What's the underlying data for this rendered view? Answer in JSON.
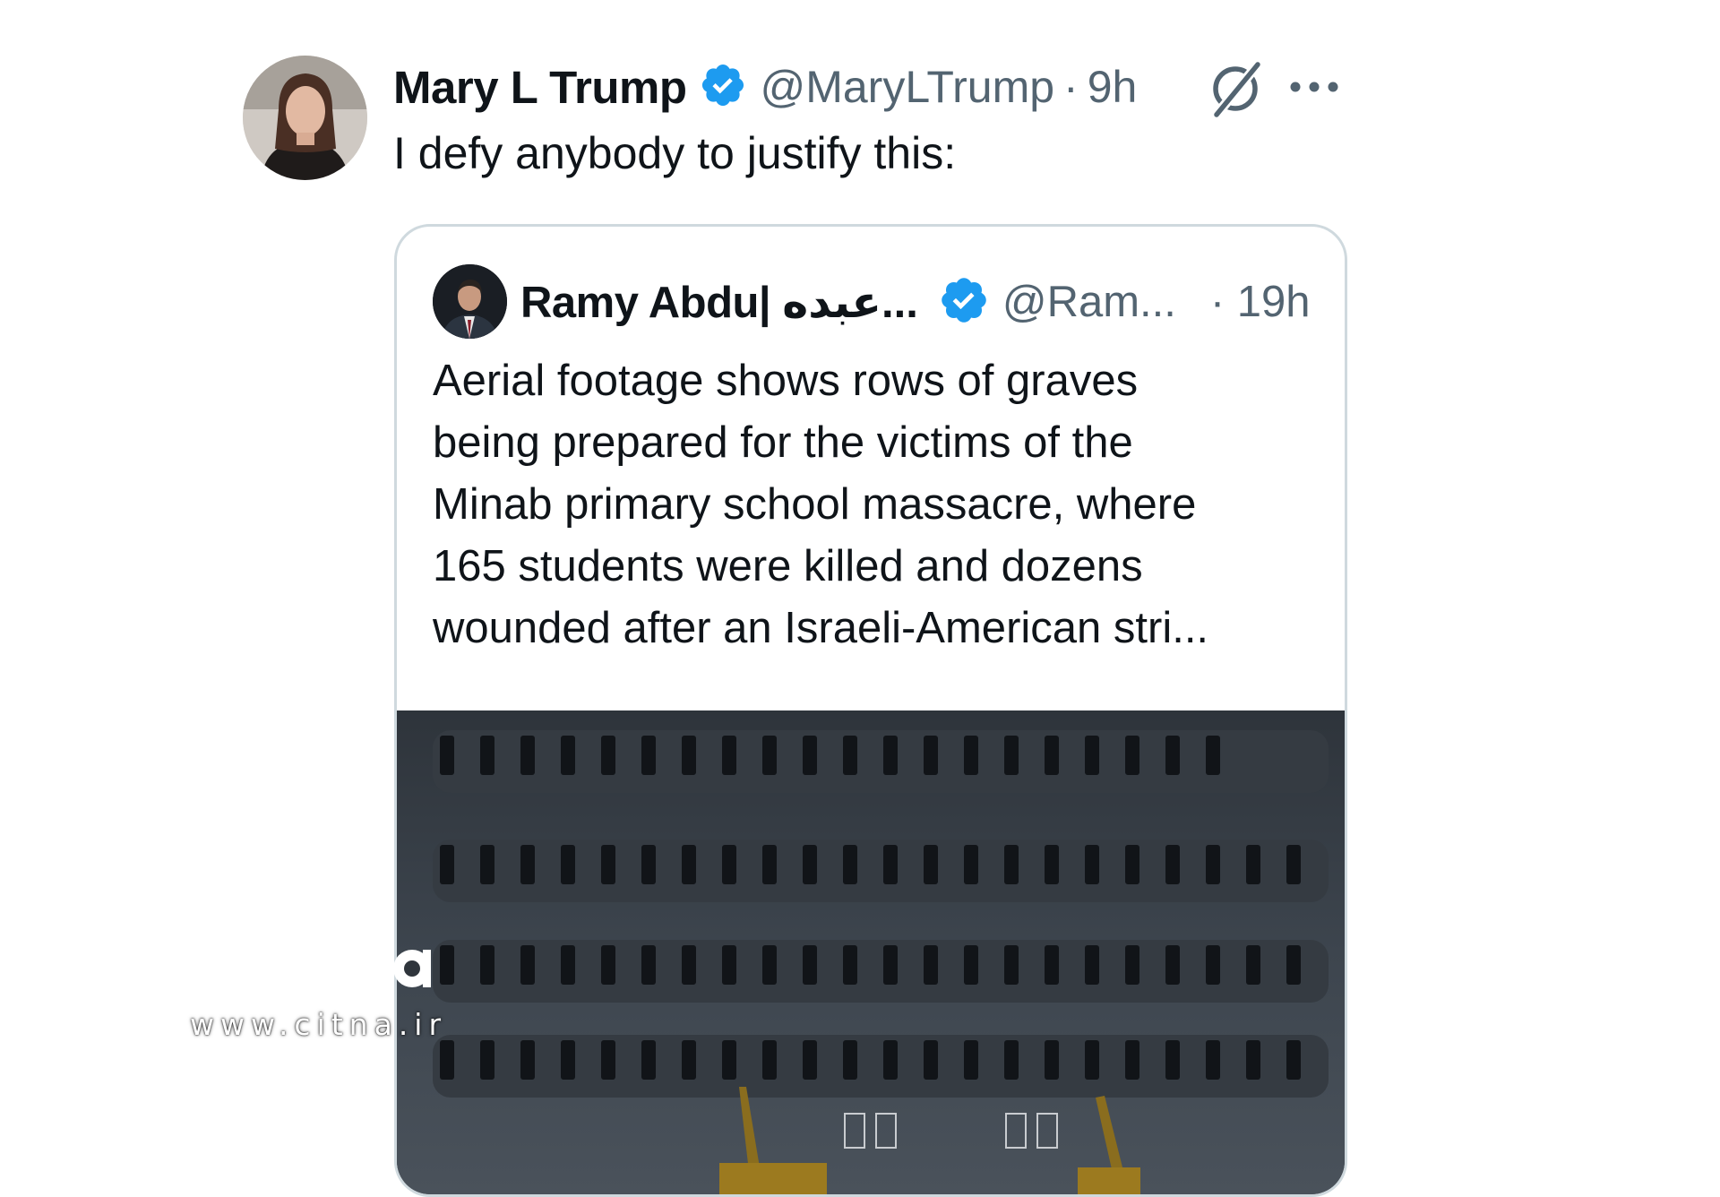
{
  "tweet": {
    "author_name": "Mary L Trump",
    "handle": "@MaryLTrump",
    "separator": "·",
    "time": "9h",
    "text": "I defy anybody to justify this:",
    "icons": [
      "verified-badge-icon",
      "grok-icon",
      "more-icon"
    ]
  },
  "quoted": {
    "author_name": "Ramy Abdu| عبده...",
    "handle": "@Ram...",
    "time": "· 19h",
    "text_lines": [
      "Aerial footage shows rows of graves",
      "being prepared for the victims of the",
      "Minab primary school massacre, where",
      "165 students were killed and dozens",
      "wounded after an Israeli-American stri..."
    ]
  },
  "watermark": {
    "text": "www.citna.ir"
  },
  "colors": {
    "verified_blue": "#1d9bf0",
    "secondary_text": "#536471",
    "card_border": "#cfd9de",
    "text": "#0f1419"
  }
}
